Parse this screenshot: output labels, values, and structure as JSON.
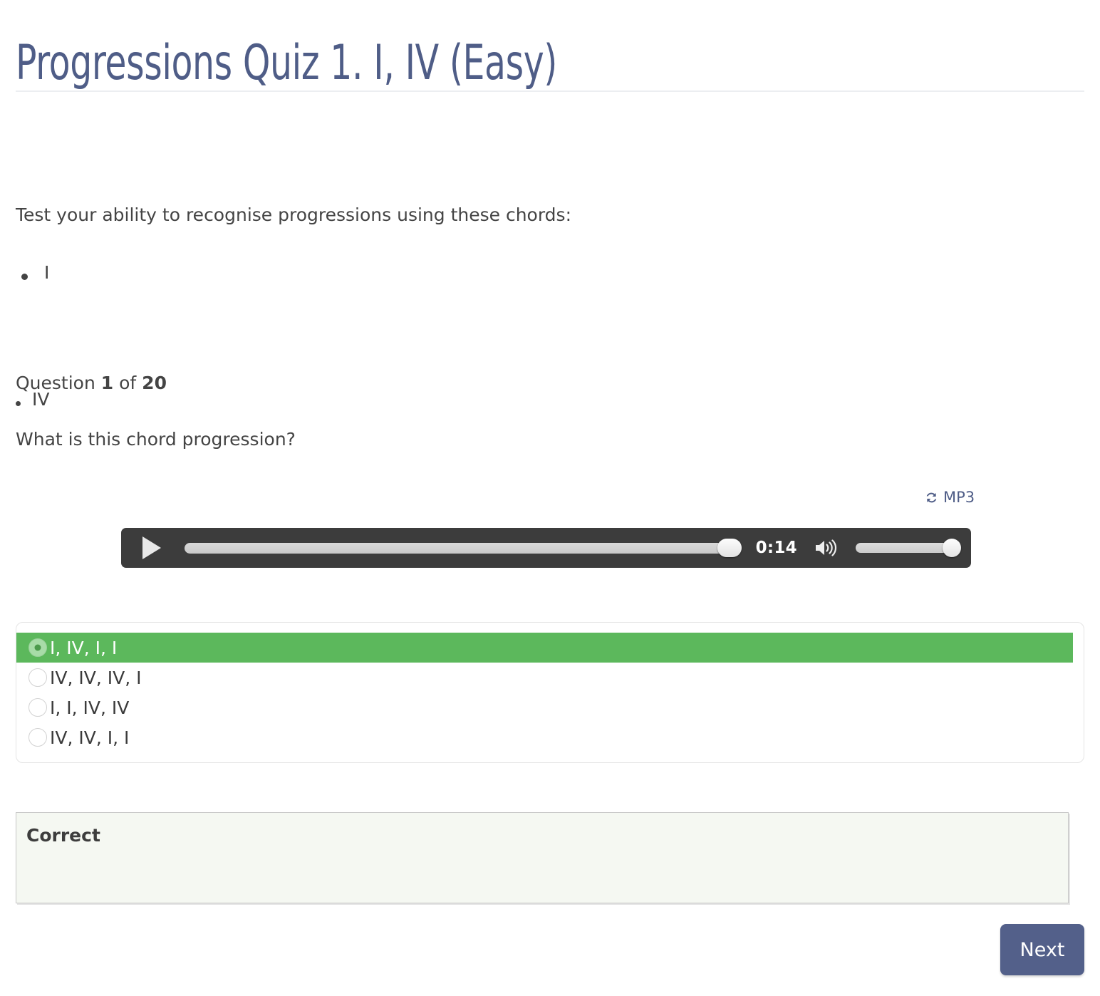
{
  "page": {
    "title": "Progressions Quiz 1. I, IV (Easy)",
    "title_color": "#4f5d87"
  },
  "intro": {
    "text": "Test your ability to recognise progressions using these chords:",
    "chords": [
      "I",
      "IV"
    ]
  },
  "question": {
    "counter_prefix": "Question ",
    "counter_current": "1",
    "counter_middle": " of ",
    "counter_total": "20",
    "prompt": "What is this chord progression?"
  },
  "media": {
    "mp3_label": "MP3",
    "mp3_icon": "refresh-icon",
    "player": {
      "play_icon": "play-icon",
      "time": "0:14",
      "speaker_icon": "speaker-volume-high-icon",
      "progress_percent": 100,
      "volume_percent": 100,
      "background_color": "#3c3c3c"
    }
  },
  "answers": {
    "selected_index": 0,
    "selected_color": "#5cb85c",
    "options": [
      {
        "label": "I, IV, I, I"
      },
      {
        "label": "IV, IV, IV, I"
      },
      {
        "label": "I, I, IV, IV"
      },
      {
        "label": "IV, IV, I, I"
      }
    ]
  },
  "feedback": {
    "title": "Correct",
    "background_color": "#f5f8f2"
  },
  "footer": {
    "next_label": "Next",
    "next_color": "#53608a"
  }
}
